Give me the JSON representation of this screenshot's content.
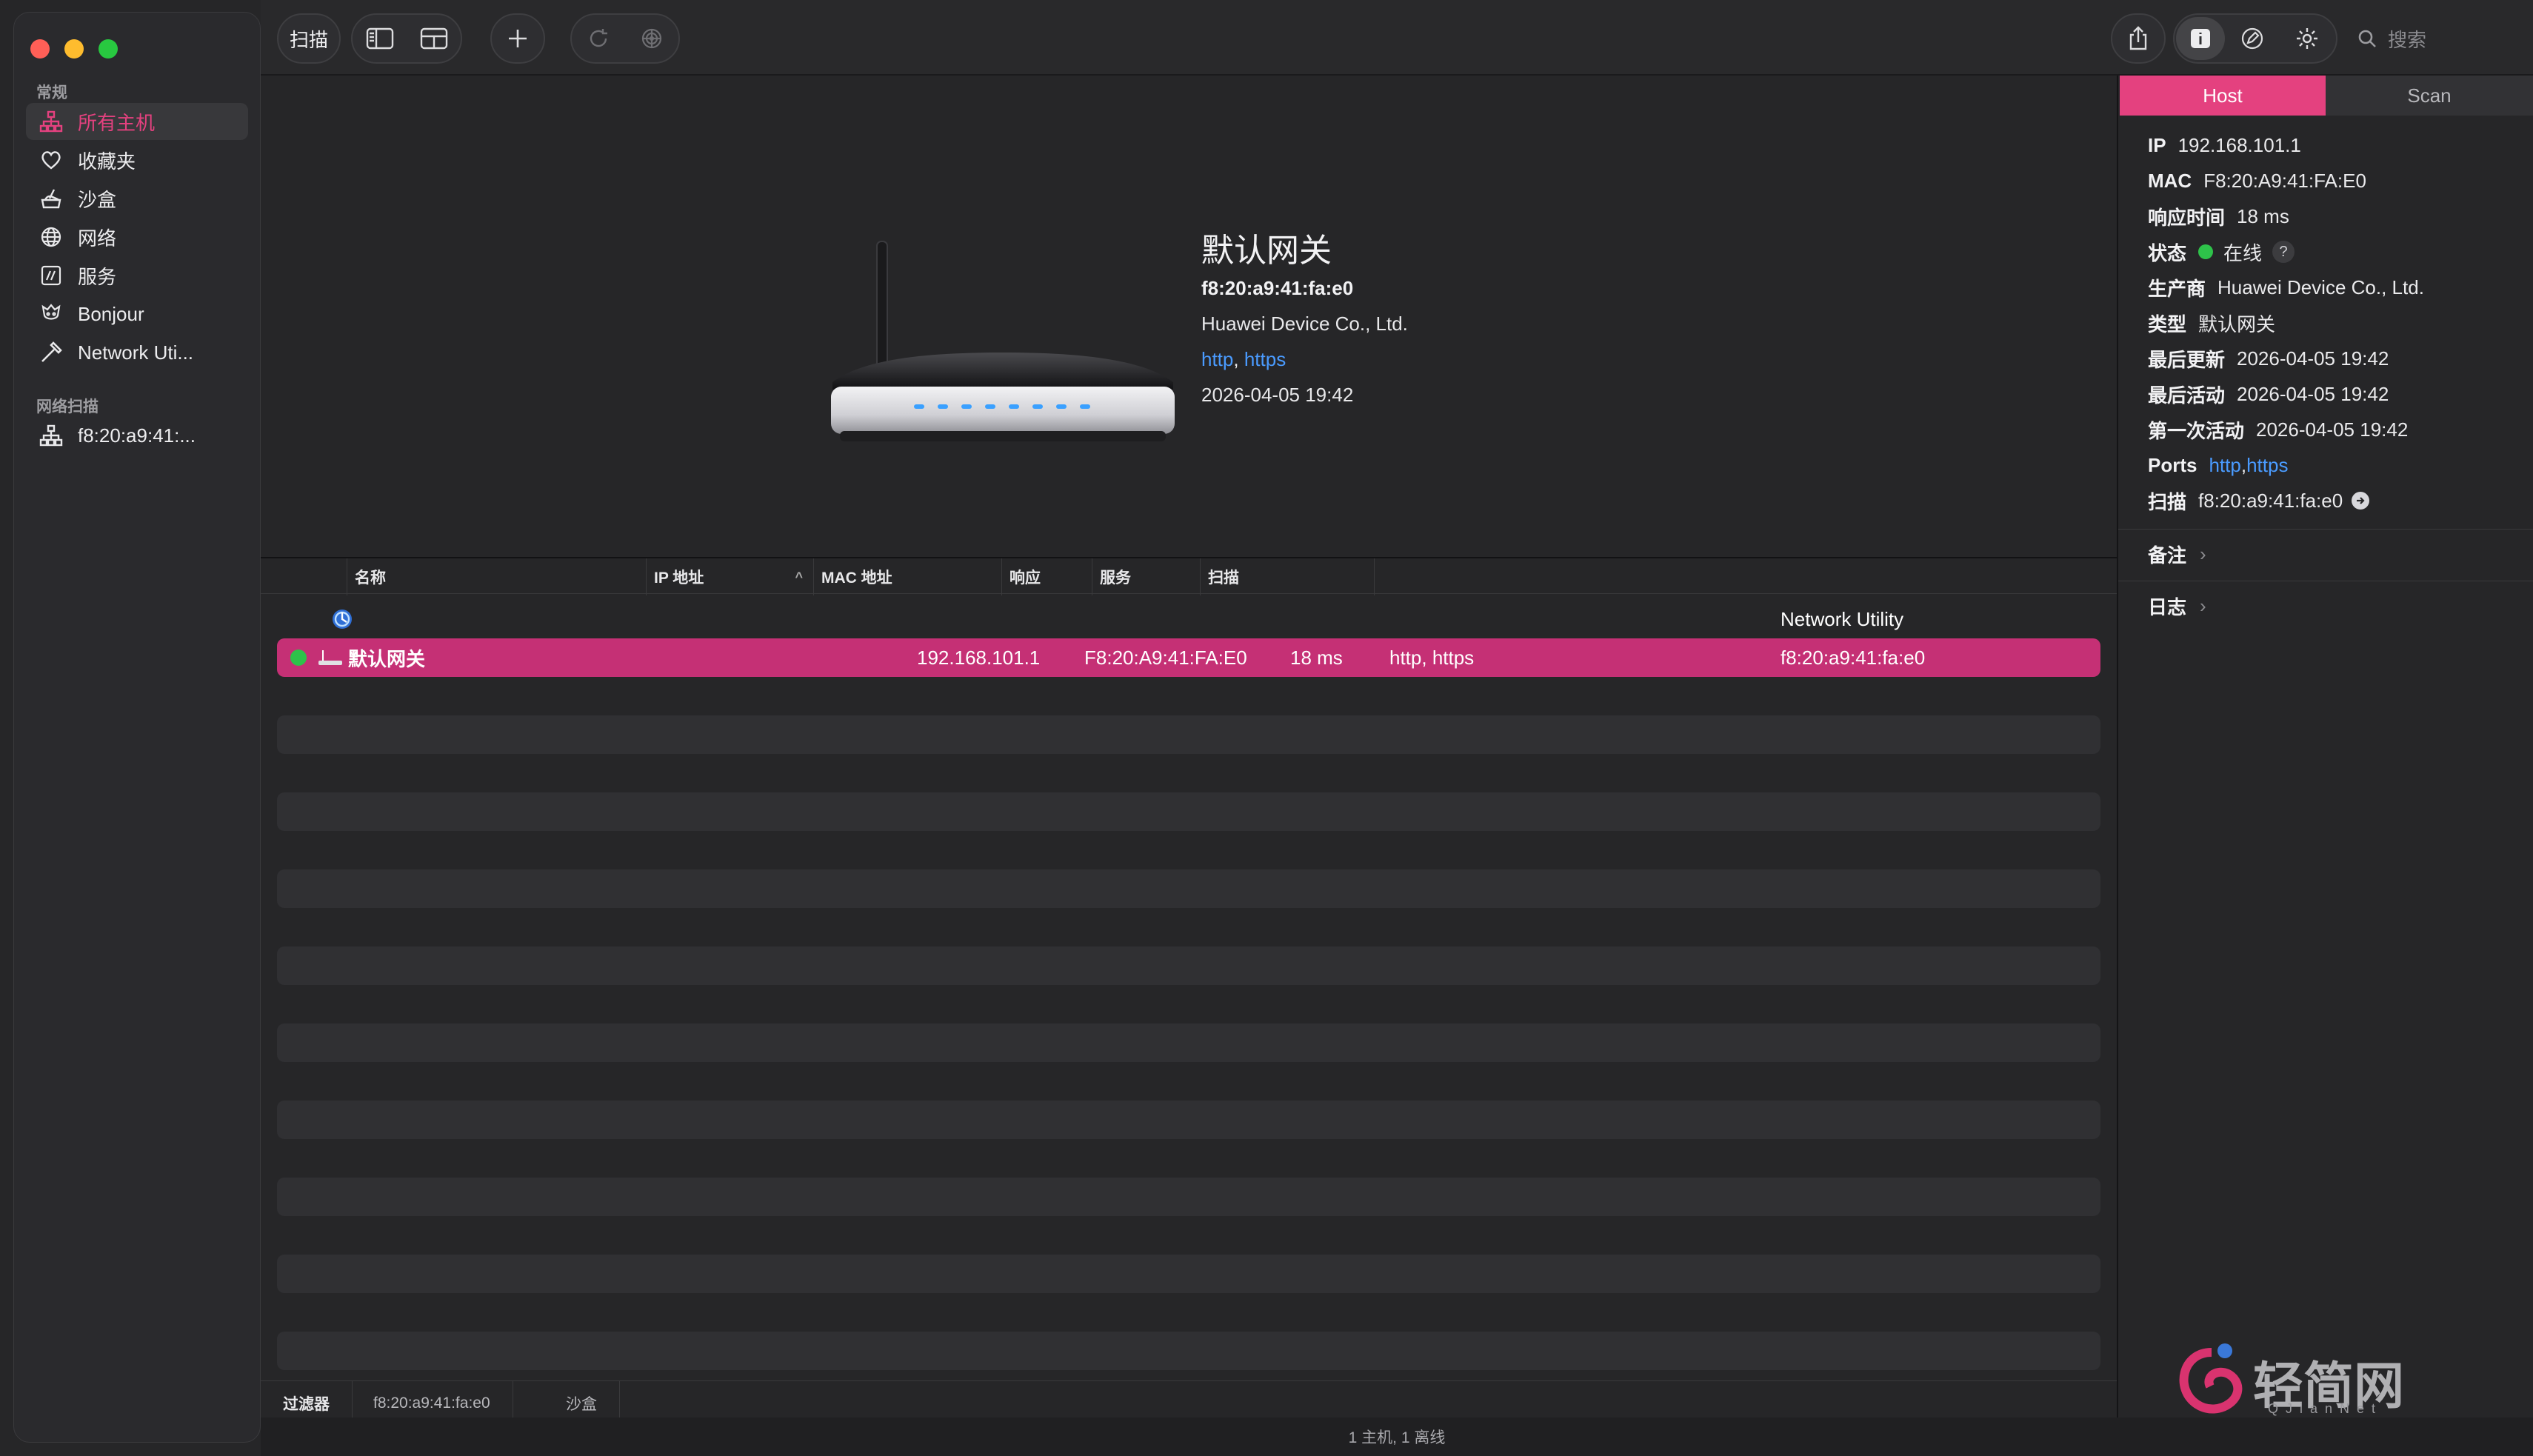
{
  "toolbar": {
    "scan_label": "扫描",
    "search_placeholder": "搜索"
  },
  "sidebar": {
    "section_general": "常规",
    "items": [
      {
        "label": "所有主机",
        "icon": "network-tree-icon",
        "active": true
      },
      {
        "label": "收藏夹",
        "icon": "heart-icon"
      },
      {
        "label": "沙盒",
        "icon": "sandbox-icon"
      },
      {
        "label": "网络",
        "icon": "globe-icon"
      },
      {
        "label": "服务",
        "icon": "service-icon"
      },
      {
        "label": "Bonjour",
        "icon": "bonjour-icon"
      },
      {
        "label": "Network Uti...",
        "icon": "hammer-icon"
      }
    ],
    "section_scans": "网络扫描",
    "scan_items": [
      {
        "label": "f8:20:a9:41:...",
        "icon": "network-tree-icon"
      }
    ]
  },
  "hero": {
    "title": "默认网关",
    "mac": "f8:20:a9:41:fa:e0",
    "vendor": "Huawei Device Co., Ltd.",
    "port1": "http",
    "sep": ", ",
    "port2": "https",
    "date": "2026-04-05 19:42"
  },
  "table": {
    "columns": {
      "name": "名称",
      "ip": "IP 地址",
      "mac": "MAC 地址",
      "response": "响应",
      "services": "服务",
      "scan": "扫描"
    },
    "group_label": "Network Utility",
    "rows": [
      {
        "name": "默认网关",
        "ip": "192.168.101.1",
        "mac": "F8:20:A9:41:FA:E0",
        "response": "18 ms",
        "services": "http, https",
        "scan": "f8:20:a9:41:fa:e0"
      }
    ]
  },
  "bottom_bar": {
    "filter": "过滤器",
    "scan": "f8:20:a9:41:fa:e0",
    "sandbox": "沙盒"
  },
  "status_text": "1 主机, 1 离线",
  "inspector": {
    "tabs": [
      "Host",
      "Scan"
    ],
    "ip_k": "IP",
    "ip_v": "192.168.101.1",
    "mac_k": "MAC",
    "mac_v": "F8:20:A9:41:FA:E0",
    "resp_k": "响应时间",
    "resp_v": "18 ms",
    "state_k": "状态",
    "state_v": "在线",
    "state_help": "?",
    "vendor_k": "生产商",
    "vendor_v": "Huawei Device Co., Ltd.",
    "type_k": "类型",
    "type_v": "默认网关",
    "updated_k": "最后更新",
    "updated_v": "2026-04-05 19:42",
    "active_k": "最后活动",
    "active_v": "2026-04-05 19:42",
    "first_k": "第一次活动",
    "first_v": "2026-04-05 19:42",
    "ports_k": "Ports",
    "ports_v1": "http",
    "ports_sep": ", ",
    "ports_v2": "https",
    "scan_k": "扫描",
    "scan_v": "f8:20:a9:41:fa:e0",
    "notes": "备注",
    "log": "日志"
  },
  "watermark": {
    "text": "轻简网",
    "sub": "QJianNet"
  },
  "colors": {
    "accent": "#e4417f",
    "selection": "#c53075",
    "online": "#2ec24a",
    "link": "#4a9bff"
  }
}
